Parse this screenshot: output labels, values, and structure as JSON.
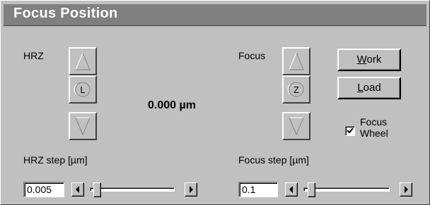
{
  "window": {
    "title": "Focus Position"
  },
  "hrz": {
    "label": "HRZ",
    "center_button_label": "L",
    "step_label": "HRZ step [µm]",
    "step_value": "0.005",
    "slider_fraction": 0.05
  },
  "readout": {
    "position_value": "0.000 µm"
  },
  "focus": {
    "label": "Focus",
    "center_button_label": "Z",
    "step_label": "Focus step [µm]",
    "step_value": "0.1",
    "slider_fraction": 0.05
  },
  "buttons": {
    "work_prefix": "",
    "work_mnemonic": "W",
    "work_rest": "ork",
    "load_mnemonic": "L",
    "load_rest": "oad"
  },
  "focus_wheel": {
    "label_line1": "Focus",
    "label_line2": "Wheel",
    "checked": true
  },
  "icons": {
    "up": "triangle-up-icon",
    "down": "triangle-down-icon",
    "left": "triangle-left-icon",
    "right": "triangle-right-icon",
    "check": "checkmark-icon"
  }
}
